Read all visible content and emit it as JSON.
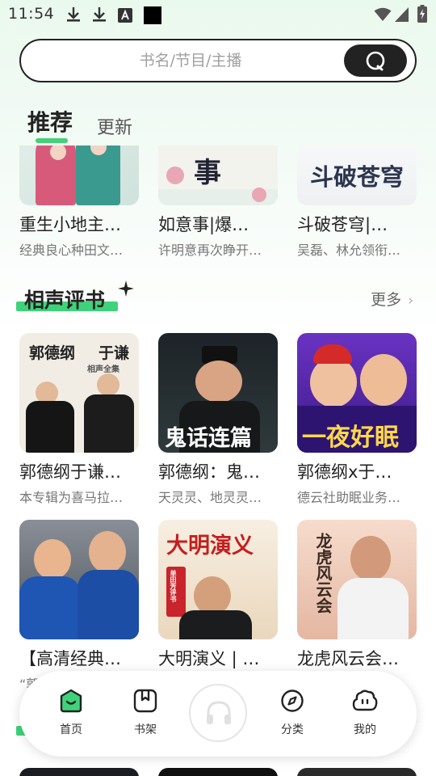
{
  "status_bar": {
    "time": "11:54",
    "left_icons": [
      "download-icon",
      "download-icon",
      "text-notification-icon",
      "black-square-icon"
    ],
    "right_icons": [
      "wifi-icon",
      "signal-icon",
      "battery-charging-icon"
    ]
  },
  "search": {
    "placeholder": "书名/节目/主播",
    "button_icon": "search-icon"
  },
  "tabs": [
    {
      "label": "推荐",
      "active": true
    },
    {
      "label": "更新",
      "active": false
    }
  ],
  "recommend_row": [
    {
      "title": "重生小地主…",
      "subtitle": "经典良心种田文…",
      "cover_text": ""
    },
    {
      "title": "如意事|爆…",
      "subtitle": "许明意再次睁开…",
      "cover_text": "事"
    },
    {
      "title": "斗破苍穹|…",
      "subtitle": "吴磊、林允领衔…",
      "cover_text": "斗破苍穹"
    }
  ],
  "section_crosstalk": {
    "title": "相声评书",
    "more_label": "更多",
    "items": [
      {
        "title": "郭德纲于谦…",
        "subtitle": "本专辑为喜马拉…",
        "cover_text": [
          "郭德纲",
          "于谦",
          "相声全集"
        ]
      },
      {
        "title": "郭德纲：鬼…",
        "subtitle": "天灵灵、地灵灵…",
        "cover_text": [
          "鬼话连篇"
        ]
      },
      {
        "title": "郭德纲x于…",
        "subtitle": "德云社助眠业务…",
        "cover_text": [
          "一夜好眠"
        ]
      },
      {
        "title": "【高清经典…",
        "subtitle": "“郭…",
        "cover_text": []
      },
      {
        "title": "大明演义 | …",
        "subtitle": "",
        "cover_text": [
          "大明演义",
          "单田芳评书"
        ]
      },
      {
        "title": "龙虎风云会…",
        "subtitle": "",
        "cover_text": [
          "龙虎风云会"
        ]
      }
    ]
  },
  "bottom_nav": [
    {
      "label": "首页",
      "icon": "home-icon",
      "active": true
    },
    {
      "label": "书架",
      "icon": "bookshelf-icon",
      "active": false
    },
    {
      "label": "分类",
      "icon": "compass-icon",
      "active": false
    },
    {
      "label": "我的",
      "icon": "profile-icon",
      "active": false
    }
  ],
  "player_icon": "headphones-icon",
  "colors": {
    "accent": "#3ed37a",
    "dark": "#222222"
  }
}
